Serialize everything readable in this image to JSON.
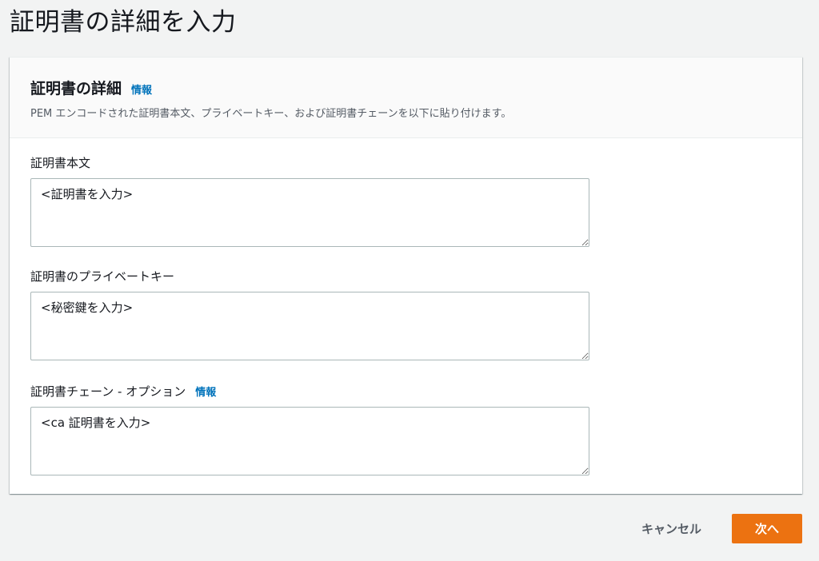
{
  "page": {
    "title": "証明書の詳細を入力"
  },
  "panel": {
    "heading": "証明書の詳細",
    "info_label": "情報",
    "description": "PEM エンコードされた証明書本文、プライベートキー、および証明書チェーンを以下に貼り付けます。"
  },
  "fields": [
    {
      "label": "証明書本文",
      "placeholder": "<証明書を入力>"
    },
    {
      "label": "証明書のプライベートキー",
      "placeholder": "<秘密鍵を入力>"
    },
    {
      "label": "証明書チェーン - オプション",
      "info_label": "情報",
      "placeholder": "<ca 証明書を入力>"
    }
  ],
  "footer": {
    "cancel_label": "キャンセル",
    "next_label": "次へ"
  },
  "colors": {
    "accent": "#ec7211",
    "link": "#0073bb",
    "background": "#f2f3f3"
  }
}
